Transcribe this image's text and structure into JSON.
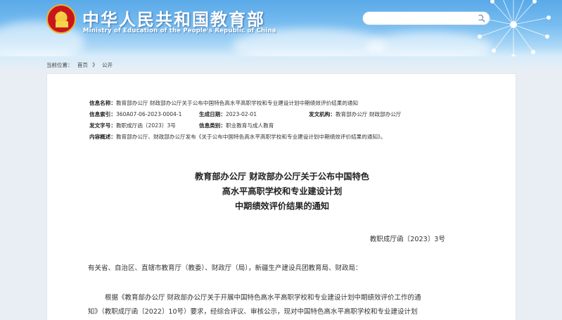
{
  "header": {
    "title": "中华人民共和国教育部",
    "subtitle": "Ministry of Education of the People's Republic of China",
    "search": {
      "placeholder": "",
      "value": ""
    }
  },
  "breadcrumb": {
    "label": "当前位置：",
    "items": [
      "首页",
      "公开"
    ],
    "separator": "》"
  },
  "meta": {
    "info_name_label": "信息名称：",
    "info_name": "教育部办公厅 财政部办公厅关于公布中国特色高水平高职学校和专业建设计划中期绩效评价结果的通知",
    "index_label": "信息索引：",
    "index": "360A07-06-2023-0004-1",
    "date_label": "生成日期：",
    "date": "2023-02-01",
    "issuer_label": "发文机构：",
    "issuer": "教育部办公厅 财政部办公厅",
    "doc_no_label": "发文字号：",
    "doc_no": "教职成厅函〔2023〕3号",
    "category_label": "信息类别：",
    "category": "职业教育与成人教育",
    "summary_label": "内容概述：",
    "summary": "教育部办公厅、财政部办公厅发布《关于公布中国特色高水平高职学校和专业建设计划中期绩效评价结果的通知》。"
  },
  "document": {
    "title_lines": [
      "教育部办公厅 财政部办公厅关于公布中国特色",
      "高水平高职学校和专业建设计划",
      "中期绩效评价结果的通知"
    ],
    "number": "教职成厅函〔2023〕3号",
    "addressee": "有关省、自治区、直辖市教育厅（教委）、财政厅（局），新疆生产建设兵团教育局、财政局：",
    "body_line1": "根据《教育部办公厅 财政部办公厅关于开展中国特色高水平高职学校和专业建设计划中期绩效评价工作的通",
    "body_line2": "知》（教职成厅函〔2022〕10号）要求，经综合评议、审核公示，现对中国特色高水平高职学校和专业建设计划"
  },
  "colors": {
    "header_sky": "#5aa9e8",
    "emblem_red": "#c8161d",
    "emblem_gold": "#f5c842",
    "page_bg": "#e9eef4",
    "text": "#333333"
  },
  "icons": [
    "national-emblem-icon",
    "search-icon",
    "dandelion-decoration"
  ]
}
